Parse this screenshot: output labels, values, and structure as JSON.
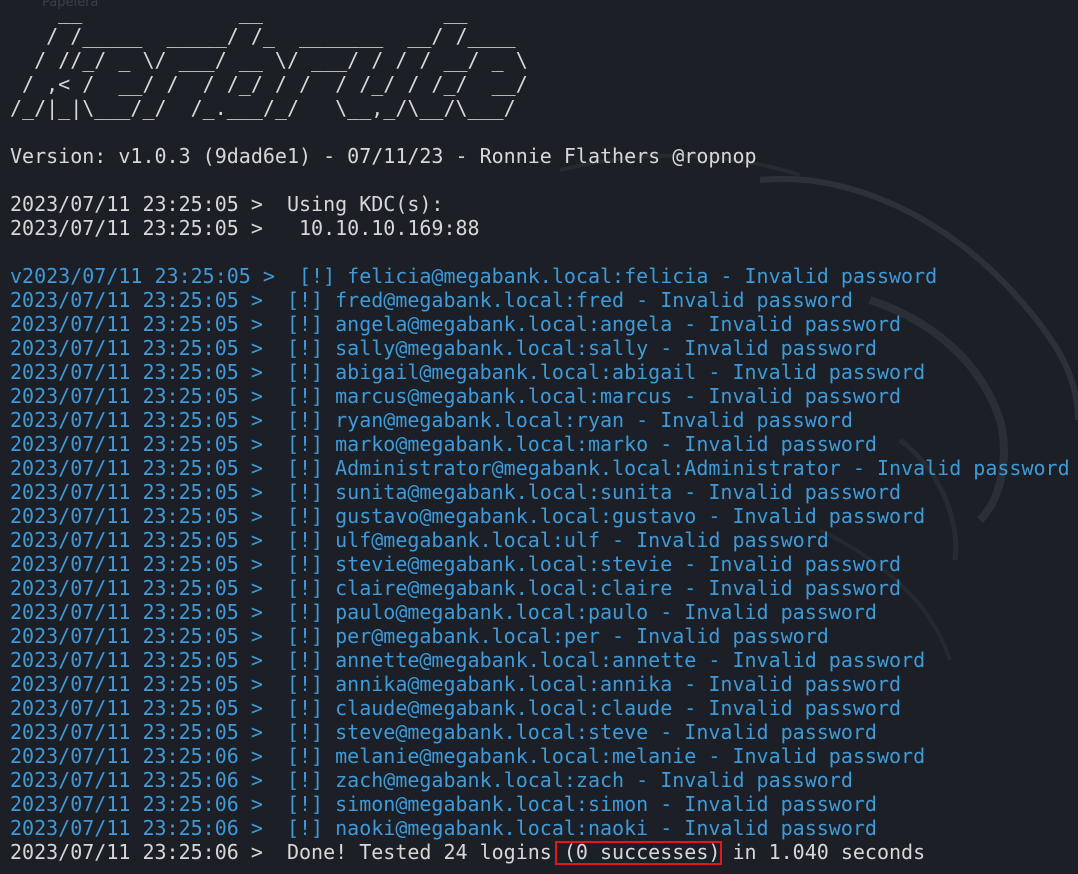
{
  "desktop": {
    "ghost_label": "Papelera"
  },
  "terminal": {
    "banner": "    __             __               __     \n   / /_____  _____/ /_  _______  __/ /____ \n  / //_/ _ \\/ ___/ __ \\/ ___/ / / / __/ _ \\\n / ,< /  __/ /  / /_/ / /  / /_/ / /_/  __/\n/_/|_|\\___/_/  /_.___/_/   \\__,_/\\__/\\___/ ",
    "version_line": "Version: v1.0.3 (9dad6e1) - 07/11/23 - Ronnie Flathers @ropnop",
    "kdc_lines": [
      "2023/07/11 23:25:05 >  Using KDC(s):",
      "2023/07/11 23:25:05 >   10.10.10.169:88"
    ],
    "result_lines": [
      "v2023/07/11 23:25:05 >  [!] felicia@megabank.local:felicia - Invalid password",
      "2023/07/11 23:25:05 >  [!] fred@megabank.local:fred - Invalid password",
      "2023/07/11 23:25:05 >  [!] angela@megabank.local:angela - Invalid password",
      "2023/07/11 23:25:05 >  [!] sally@megabank.local:sally - Invalid password",
      "2023/07/11 23:25:05 >  [!] abigail@megabank.local:abigail - Invalid password",
      "2023/07/11 23:25:05 >  [!] marcus@megabank.local:marcus - Invalid password",
      "2023/07/11 23:25:05 >  [!] ryan@megabank.local:ryan - Invalid password",
      "2023/07/11 23:25:05 >  [!] marko@megabank.local:marko - Invalid password",
      "2023/07/11 23:25:05 >  [!] Administrator@megabank.local:Administrator - Invalid password",
      "2023/07/11 23:25:05 >  [!] sunita@megabank.local:sunita - Invalid password",
      "2023/07/11 23:25:05 >  [!] gustavo@megabank.local:gustavo - Invalid password",
      "2023/07/11 23:25:05 >  [!] ulf@megabank.local:ulf - Invalid password",
      "2023/07/11 23:25:05 >  [!] stevie@megabank.local:stevie - Invalid password",
      "2023/07/11 23:25:05 >  [!] claire@megabank.local:claire - Invalid password",
      "2023/07/11 23:25:05 >  [!] paulo@megabank.local:paulo - Invalid password",
      "2023/07/11 23:25:05 >  [!] per@megabank.local:per - Invalid password",
      "2023/07/11 23:25:05 >  [!] annette@megabank.local:annette - Invalid password",
      "2023/07/11 23:25:05 >  [!] annika@megabank.local:annika - Invalid password",
      "2023/07/11 23:25:05 >  [!] claude@megabank.local:claude - Invalid password",
      "2023/07/11 23:25:05 >  [!] steve@megabank.local:steve - Invalid password",
      "2023/07/11 23:25:06 >  [!] melanie@megabank.local:melanie - Invalid password",
      "2023/07/11 23:25:06 >  [!] zach@megabank.local:zach - Invalid password",
      "2023/07/11 23:25:06 >  [!] simon@megabank.local:simon - Invalid password",
      "2023/07/11 23:25:06 >  [!] naoki@megabank.local:naoki - Invalid password"
    ],
    "done_line": {
      "prefix": "2023/07/11 23:25:06 >  Done! Tested 24 logins ",
      "highlighted": "(0 successes)",
      "suffix": " in 1.040 seconds"
    }
  },
  "colors": {
    "background": "#1c1f26",
    "text": "#d7d7d7",
    "result_text": "#3e9ad8",
    "highlight_border": "#e0181b"
  }
}
